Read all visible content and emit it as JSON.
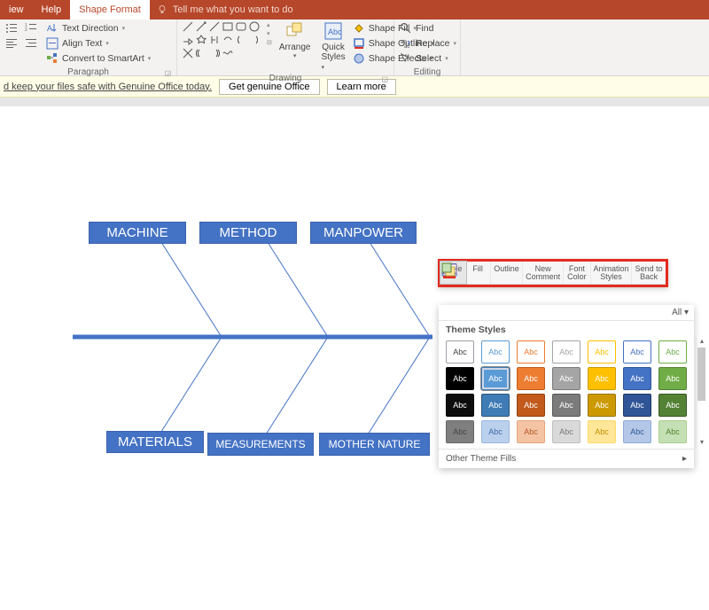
{
  "tabs": {
    "view": "iew",
    "help": "Help",
    "shape_format": "Shape Format",
    "tell_me": "Tell me what you want to do"
  },
  "ribbon": {
    "paragraph": {
      "label": "Paragraph",
      "text_direction": "Text Direction",
      "align_text": "Align Text",
      "convert_smartart": "Convert to SmartArt"
    },
    "drawing": {
      "label": "Drawing",
      "arrange": "Arrange",
      "quick_styles": "Quick",
      "quick_styles2": "Styles",
      "shape_fill": "Shape Fill",
      "shape_outline": "Shape Outline",
      "shape_effects": "Shape Effects"
    },
    "editing": {
      "label": "Editing",
      "find": "Find",
      "replace": "Replace",
      "select": "Select"
    }
  },
  "banner": {
    "text": "d keep your files safe with Genuine Office today.",
    "btn1": "Get genuine Office",
    "btn2": "Learn more"
  },
  "diagram": {
    "machine": "MACHINE",
    "method": "METHOD",
    "manpower": "MANPOWER",
    "materials": "MATERIALS",
    "measurements": "MEASUREMENTS",
    "mother_nature": "MOTHER NATURE"
  },
  "ctx": {
    "style": "Style",
    "fill": "Fill",
    "outline": "Outline",
    "new_comment": "New\nComment",
    "font_color": "Font\nColor",
    "animation_styles": "Animation\nStyles",
    "send_to_back": "Send to\nBack",
    "all": "All ▾",
    "theme_styles": "Theme Styles",
    "other_fills": "Other Theme Fills",
    "swatch_label": "Abc",
    "swatches": [
      [
        {
          "bg": "#ffffff",
          "fg": "#444",
          "bd": "#9aa0a6"
        },
        {
          "bg": "#ffffff",
          "fg": "#5b9bd5",
          "bd": "#5b9bd5"
        },
        {
          "bg": "#ffffff",
          "fg": "#ed7d31",
          "bd": "#ed7d31"
        },
        {
          "bg": "#ffffff",
          "fg": "#a5a5a5",
          "bd": "#a5a5a5"
        },
        {
          "bg": "#ffffff",
          "fg": "#ffc000",
          "bd": "#ffc000"
        },
        {
          "bg": "#ffffff",
          "fg": "#4472c4",
          "bd": "#4472c4"
        },
        {
          "bg": "#ffffff",
          "fg": "#70ad47",
          "bd": "#70ad47"
        }
      ],
      [
        {
          "bg": "#000000",
          "fg": "#ffffff",
          "bd": "#000"
        },
        {
          "bg": "#5b9bd5",
          "fg": "#ffffff",
          "bd": "#3f7cb5",
          "sel": true
        },
        {
          "bg": "#ed7d31",
          "fg": "#ffffff",
          "bd": "#c15a1a"
        },
        {
          "bg": "#a5a5a5",
          "fg": "#ffffff",
          "bd": "#7b7b7b"
        },
        {
          "bg": "#ffc000",
          "fg": "#ffffff",
          "bd": "#cc9a00"
        },
        {
          "bg": "#4472c4",
          "fg": "#ffffff",
          "bd": "#2f5597"
        },
        {
          "bg": "#70ad47",
          "fg": "#ffffff",
          "bd": "#548235"
        }
      ],
      [
        {
          "bg": "#0d0d0d",
          "fg": "#ffffff",
          "bd": "#000"
        },
        {
          "bg": "#3f7cb5",
          "fg": "#ffffff",
          "bd": "#2a557e"
        },
        {
          "bg": "#c15a1a",
          "fg": "#ffffff",
          "bd": "#8f4313"
        },
        {
          "bg": "#7b7b7b",
          "fg": "#ffffff",
          "bd": "#595959"
        },
        {
          "bg": "#cc9a00",
          "fg": "#ffffff",
          "bd": "#997300"
        },
        {
          "bg": "#2f5597",
          "fg": "#ffffff",
          "bd": "#1f3864"
        },
        {
          "bg": "#548235",
          "fg": "#ffffff",
          "bd": "#385723"
        }
      ],
      [
        {
          "bg": "#7f7f7f",
          "fg": "#444",
          "bd": "#666"
        },
        {
          "bg": "#bbd0ec",
          "fg": "#3f6aa8",
          "bd": "#9bb8dc"
        },
        {
          "bg": "#f4c3a3",
          "fg": "#b35a26",
          "bd": "#e6a67f"
        },
        {
          "bg": "#d9d9d9",
          "fg": "#777",
          "bd": "#bfbfbf"
        },
        {
          "bg": "#ffe699",
          "fg": "#bf8f00",
          "bd": "#ffd966"
        },
        {
          "bg": "#b4c7e7",
          "fg": "#2f5597",
          "bd": "#8faadc"
        },
        {
          "bg": "#c5e0b4",
          "fg": "#548235",
          "bd": "#a9d08e"
        }
      ]
    ]
  }
}
